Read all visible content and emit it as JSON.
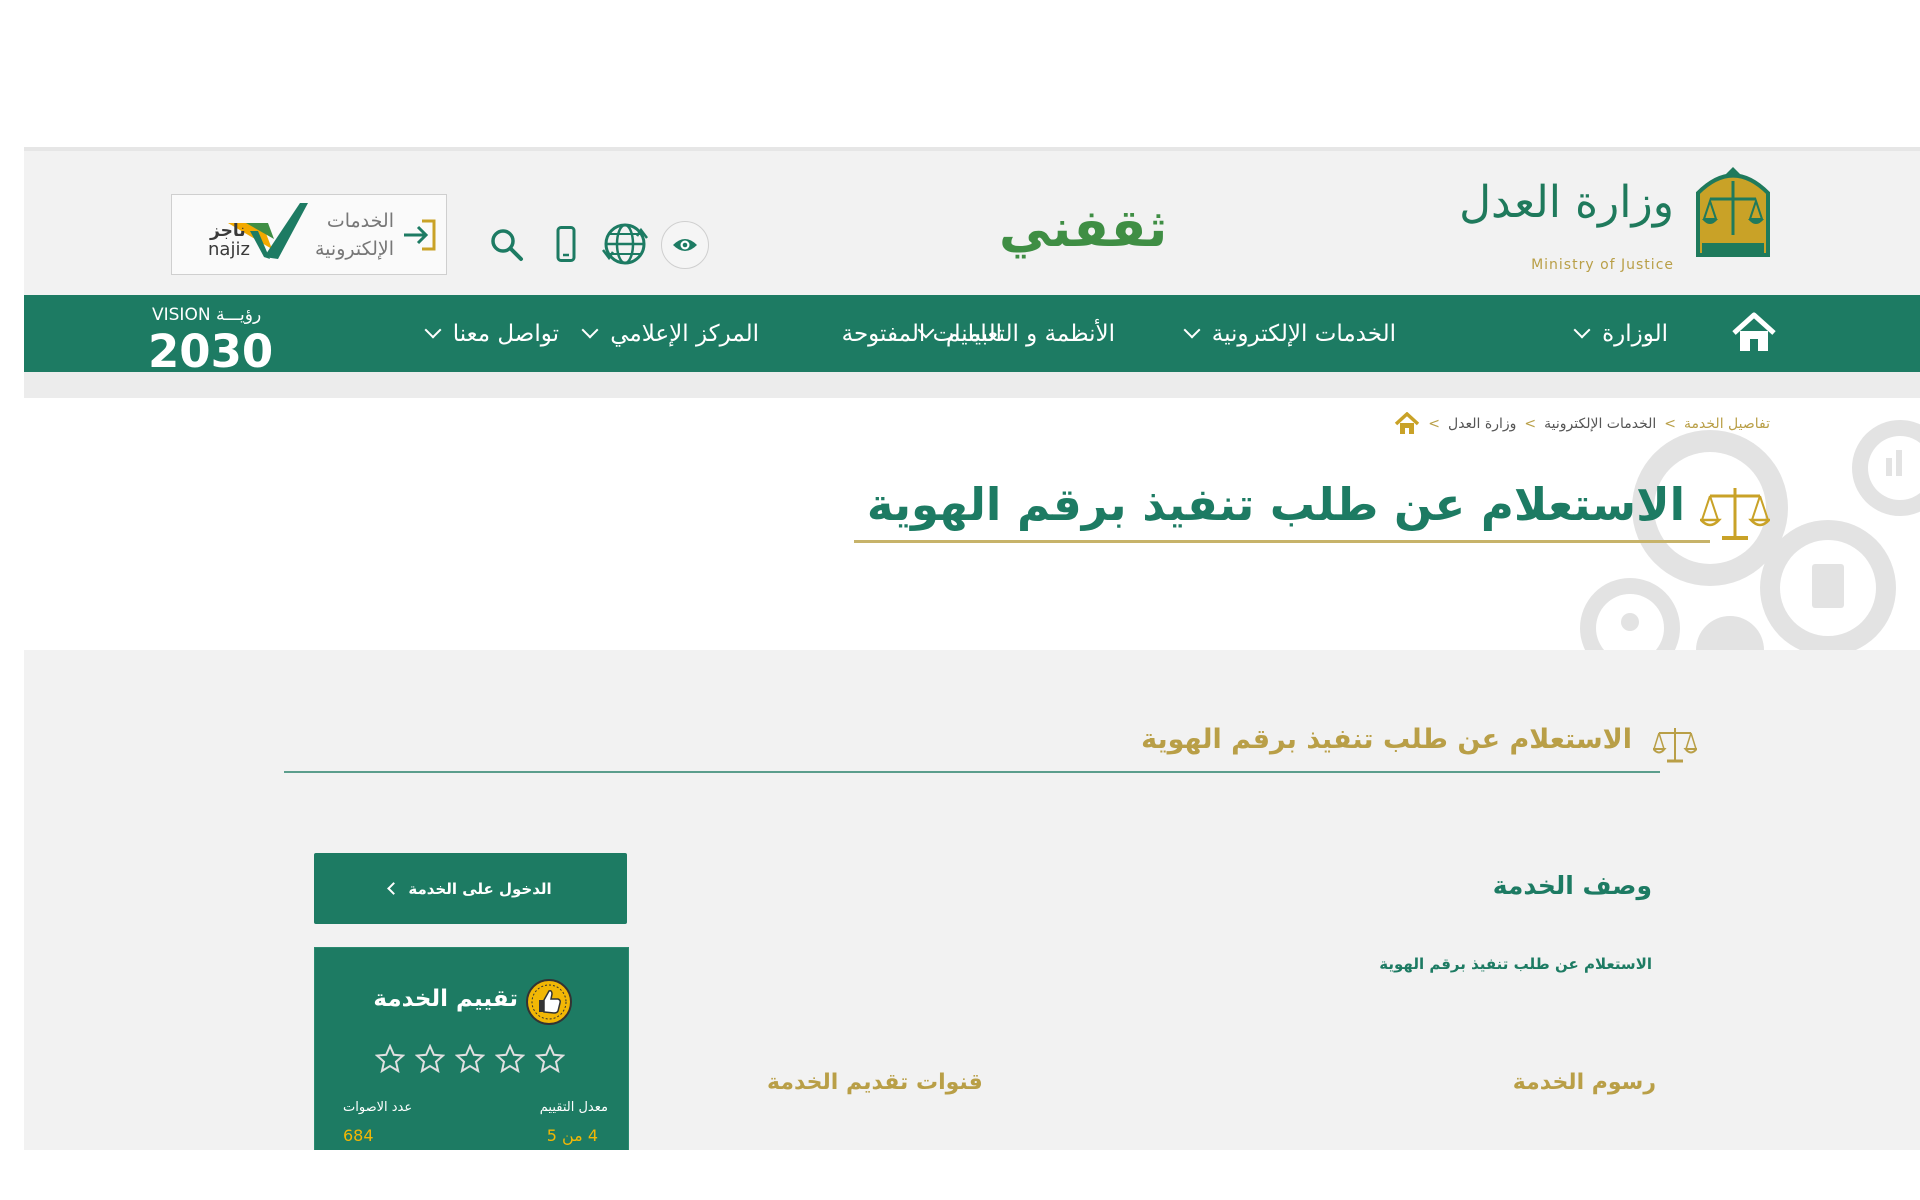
{
  "header": {
    "moj_name_ar": "وزارة العدل",
    "moj_name_en": "Ministry of Justice",
    "thaqafni": "ثقفني",
    "najiz": {
      "line1": "الخدمات",
      "line2": "الإلكترونية",
      "brand_ar": "ناجز",
      "brand_en": "najiz"
    }
  },
  "nav": {
    "items": [
      {
        "label": "الوزارة",
        "dropdown": true
      },
      {
        "label": "الخدمات الإلكترونية",
        "dropdown": true
      },
      {
        "label": "الأنظمة و التعاميم",
        "dropdown": true
      },
      {
        "label": "البيانات المفتوحة",
        "dropdown": false
      },
      {
        "label": "المركز الإعلامي",
        "dropdown": true
      },
      {
        "label": "تواصل معنا",
        "dropdown": true
      }
    ],
    "vision_top": "VISION رؤيـــة",
    "vision_year": "2030"
  },
  "breadcrumb": {
    "items": [
      "وزارة العدل",
      "الخدمات الإلكترونية",
      "تفاصيل الخدمة"
    ],
    "separator": ">"
  },
  "page": {
    "title": "الاستعلام عن طلب تنفيذ برقم الهوية",
    "section_title": "الاستعلام عن طلب تنفيذ برقم الهوية",
    "description_heading": "وصف الخدمة",
    "description_text": "الاستعلام عن طلب تنفيذ برقم الهوية",
    "fees_heading": "رسوم الخدمة",
    "channels_heading": "قنوات تقديم الخدمة",
    "enter_button": "الدخول على الخدمة"
  },
  "rating": {
    "title": "تقييم الخدمة",
    "stars_total": 5,
    "avg_label": "معدل التقييم",
    "avg_value": "4 من 5",
    "votes_label": "عدد الاصوات",
    "votes_value": "684"
  },
  "colors": {
    "primary_green": "#1d7b63",
    "gold": "#b99f47",
    "rating_value": "#f2b705"
  }
}
